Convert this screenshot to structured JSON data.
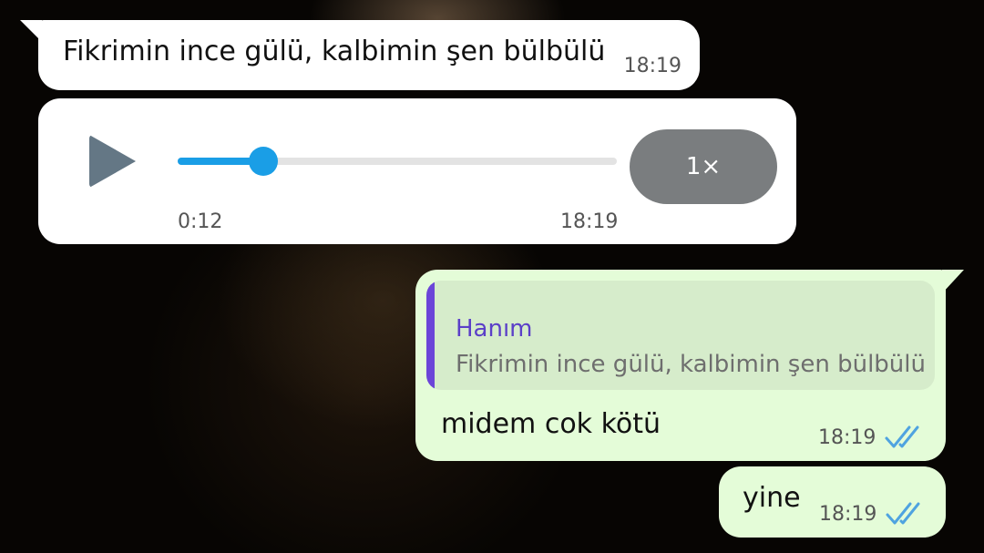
{
  "messages": {
    "incoming_text": {
      "text": "Fikrimin ince gülü, kalbimin şen bülbülü",
      "time": "18:19"
    },
    "voice": {
      "duration": "0:12",
      "time": "18:19",
      "speed": "1×",
      "progress": 0.195
    },
    "reply": {
      "quote_author": "Hanım",
      "quote_text": "Fikrimin ince gülü, kalbimin şen bülbülü",
      "text": "midem cok kötü",
      "time": "18:19",
      "status": "read"
    },
    "short": {
      "text": "yine",
      "time": "18:19",
      "status": "read"
    }
  },
  "colors": {
    "incoming_bubble": "#ffffff",
    "outgoing_bubble": "#e4fcd8",
    "accent_blue": "#1a9ee6",
    "quote_purple": "#6b45d8",
    "read_ticks": "#4fa3e0"
  },
  "icons": {
    "play": "play-icon",
    "read": "double-check-icon"
  }
}
